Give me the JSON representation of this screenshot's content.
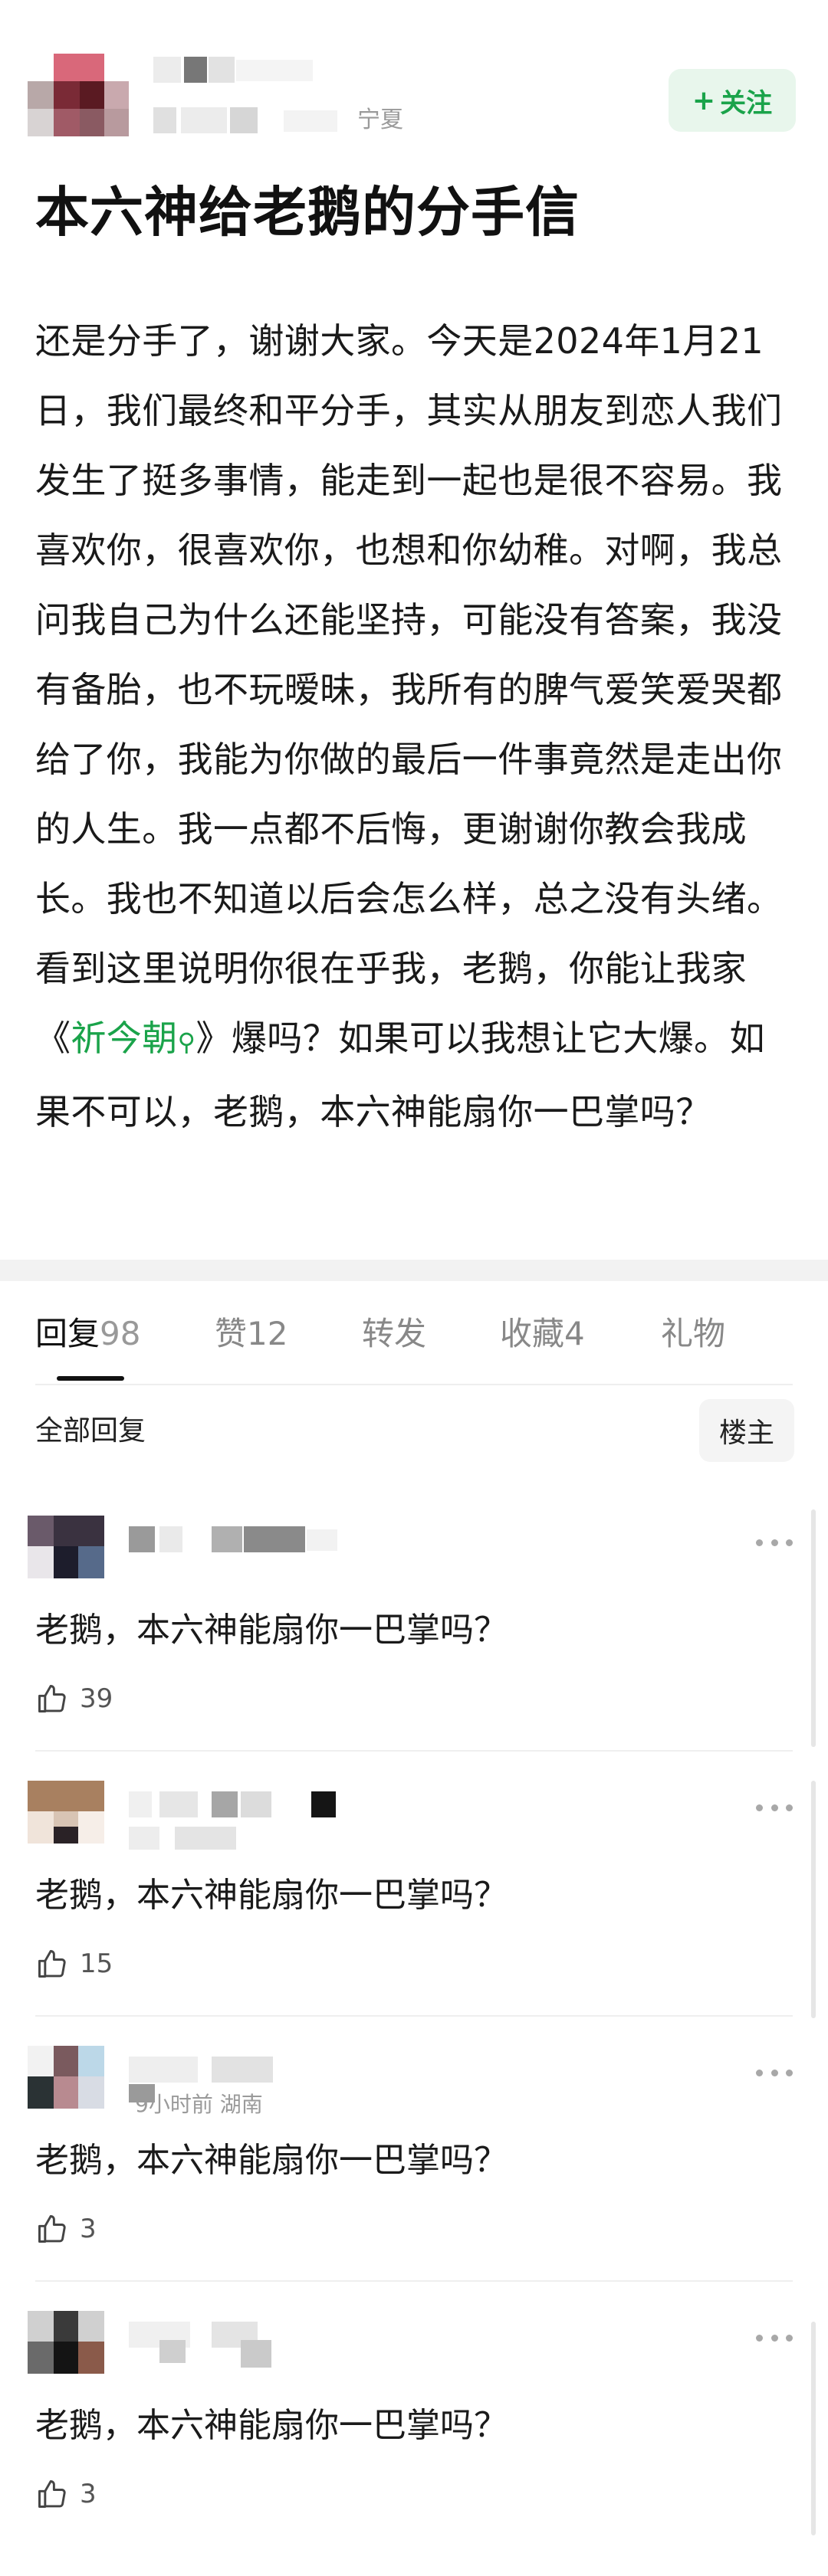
{
  "header": {
    "location": "宁夏",
    "follow_label": "关注",
    "follow_icon": "plus-icon"
  },
  "post": {
    "title": "本六神给老鹅的分手信",
    "body_before_link": "还是分手了，谢谢大家。今天是2024年1月21日，我们最终和平分手，其实从朋友到恋人我们发生了挺多事情，能走到一起也是很不容易。我喜欢你，很喜欢你，也想和你幼稚。对啊，我总问我自己为什么还能坚持，可能没有答案，我没有备胎，也不玩暧昧，我所有的脾气爱笑爱哭都给了你，我能为你做的最后一件事竟然是走出你的人生。我一点都不后悔，更谢谢你教会我成长。我也不知道以后会怎么样，总之没有头绪。看到这里说明你很在乎我，老鹅，你能让我家《",
    "link_text": "祈今朝",
    "link_icon": "search-icon",
    "body_after_link": "》爆吗？如果可以我想让它大爆。如果不可以，老鹅，本六神能扇你一巴掌吗？",
    "link_color": "#1aa34a"
  },
  "tabs": [
    {
      "label": "回复",
      "count": "98",
      "active": true
    },
    {
      "label": "赞",
      "count": "12",
      "active": false
    },
    {
      "label": "转发",
      "count": "",
      "active": false
    },
    {
      "label": "收藏",
      "count": "4",
      "active": false
    },
    {
      "label": "礼物",
      "count": "",
      "active": false
    }
  ],
  "filter": {
    "label": "全部回复",
    "host_button": "楼主"
  },
  "comments": [
    {
      "text": "老鹅，本六神能扇你一巴掌吗？",
      "likes": "39",
      "meta": ""
    },
    {
      "text": "老鹅，本六神能扇你一巴掌吗？",
      "likes": "15",
      "meta": ""
    },
    {
      "text": "老鹅，本六神能扇你一巴掌吗？",
      "likes": "3",
      "meta": "9小时前 湖南"
    },
    {
      "text": "老鹅，本六神能扇你一巴掌吗？",
      "likes": "3",
      "meta": ""
    }
  ],
  "colors": {
    "accent_green": "#1aa34a",
    "follow_bg": "#e8f6ec"
  }
}
